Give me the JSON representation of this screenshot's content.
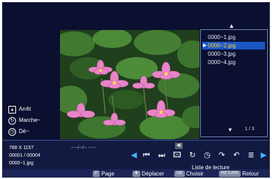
{
  "playlist": {
    "items": [
      "0000~1.jpg",
      "0000~2.jpg",
      "0000~3.jpg",
      "0000~4.jpg"
    ],
    "selected_index": 1,
    "page_counter": "1 / 3",
    "up_icon": "triangle-up-icon",
    "down_icon": "triangle-down-icon"
  },
  "options": [
    {
      "label": "Arrêt",
      "icon": "picture-icon"
    },
    {
      "label": "Marche~",
      "icon": "repeat-icon"
    },
    {
      "label": "Dé~",
      "icon": "clock-icon"
    }
  ],
  "info": {
    "resolution": "788 X 1157",
    "index": "00001 / 00004",
    "filename": "0000~1.jpg",
    "datetime": "----/--/--  --:--"
  },
  "controls": {
    "icons": [
      "arrow-left-icon",
      "previous-icon",
      "next-icon",
      "picture-icon",
      "repeat-icon",
      "clock-icon",
      "rotate-right-icon",
      "rotate-left-icon",
      "info-icon",
      "arrow-right-icon"
    ],
    "volume_icon": "speaker-icon",
    "label": "Liste de lecture"
  },
  "hints": {
    "page_key": "P",
    "page_label": "Page",
    "move_label": "Déplacer",
    "ok_key": "OK",
    "ok_label": "Choisir",
    "return_key": "RETURN",
    "return_label": "Retour"
  },
  "colors": {
    "background": "#0b1030",
    "selection": "#1a57c7",
    "selection_text": "#ffd23c",
    "accent": "#44b4ff"
  }
}
